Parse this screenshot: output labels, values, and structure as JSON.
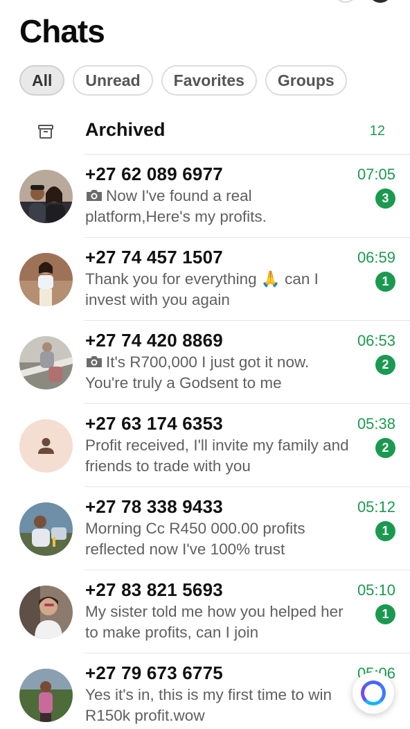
{
  "header": {
    "title": "Chats"
  },
  "filters": [
    {
      "label": "All",
      "active": true
    },
    {
      "label": "Unread",
      "active": false
    },
    {
      "label": "Favorites",
      "active": false
    },
    {
      "label": "Groups",
      "active": false
    }
  ],
  "archived": {
    "label": "Archived",
    "count": "12",
    "icon": "archive-icon"
  },
  "chats": [
    {
      "name": "+27 62 089 6977",
      "time": "07:05",
      "camera": true,
      "preview": "Now I've found a real platform,Here's my profits.",
      "unread": "3",
      "avatar": "photo-couple"
    },
    {
      "name": "+27 74 457 1507",
      "time": "06:59",
      "camera": false,
      "preview": "Thank you for everything 🙏 can I invest with you again",
      "unread": "1",
      "avatar": "photo-woman"
    },
    {
      "name": "+27 74 420 8869",
      "time": "06:53",
      "camera": true,
      "preview": "It's R700,000 I just got it now. You're truly a Godsent to me",
      "unread": "2",
      "avatar": "photo-woman-grey"
    },
    {
      "name": "+27 63 174 6353",
      "time": "05:38",
      "camera": false,
      "preview": "Profit received, I'll invite my family and friends to trade with you",
      "unread": "2",
      "avatar": "default-person-icon"
    },
    {
      "name": "+27 78 338 9433",
      "time": "05:12",
      "camera": false,
      "preview": "Morning Cc R450 000.00 profits reflected now I've 100% trust",
      "unread": "1",
      "avatar": "photo-man"
    },
    {
      "name": "+27 83 821 5693",
      "time": "05:10",
      "camera": false,
      "preview": "My sister told me how you helped her to make profits,  can I join",
      "unread": "1",
      "avatar": "photo-woman-glasses"
    },
    {
      "name": "+27 79 673 6775",
      "time": "05:06",
      "camera": false,
      "preview": "Yes it's in, this is my first time to win R150k profit.wow",
      "unread": "",
      "avatar": "photo-woman-outdoor"
    }
  ],
  "colors": {
    "accent": "#1a9a50",
    "chip_active_bg": "#e9e9ea",
    "muted_text": "#5f5f5f"
  },
  "fab": {
    "icon": "meta-ai-icon"
  }
}
